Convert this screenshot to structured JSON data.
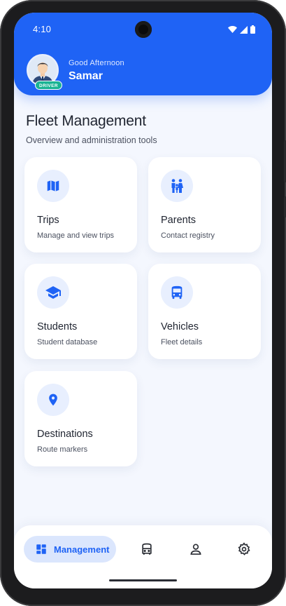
{
  "status_bar": {
    "time": "4:10"
  },
  "header": {
    "greeting": "Good Afternoon",
    "user_name": "Samar",
    "role_badge": "DRIVER"
  },
  "main": {
    "title": "Fleet Management",
    "subtitle": "Overview and administration tools",
    "cards": [
      {
        "title": "Trips",
        "subtitle": "Manage and view trips",
        "icon": "map-icon"
      },
      {
        "title": "Parents",
        "subtitle": "Contact registry",
        "icon": "family-icon"
      },
      {
        "title": "Students",
        "subtitle": "Student database",
        "icon": "graduation-cap-icon"
      },
      {
        "title": "Vehicles",
        "subtitle": "Fleet details",
        "icon": "bus-icon"
      },
      {
        "title": "Destinations",
        "subtitle": "Route markers",
        "icon": "location-pin-icon"
      }
    ]
  },
  "bottom_nav": {
    "active_label": "Management",
    "items": [
      "dashboard-icon",
      "bus-icon",
      "person-icon",
      "gear-icon"
    ]
  },
  "colors": {
    "primary": "#1f63f5",
    "background": "#f4f7fe",
    "icon_bg": "#e8effe",
    "badge": "#19b394"
  }
}
